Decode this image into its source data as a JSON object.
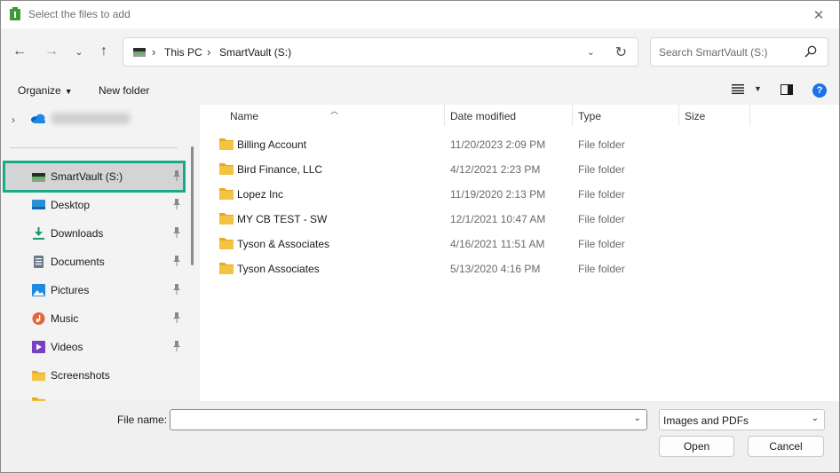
{
  "window": {
    "title": "Select the files to add"
  },
  "nav": {
    "address": {
      "segments": [
        "This PC",
        "SmartVault (S:)"
      ]
    },
    "search_placeholder": "Search SmartVault (S:)"
  },
  "commandbar": {
    "organize": "Organize",
    "new_folder": "New folder"
  },
  "sidebar": {
    "items": [
      {
        "label": "SmartVault (S:)",
        "icon": "drive-icon",
        "pinned": true,
        "selected": true
      },
      {
        "label": "Desktop",
        "icon": "desktop-icon",
        "pinned": true
      },
      {
        "label": "Downloads",
        "icon": "download-icon",
        "pinned": true
      },
      {
        "label": "Documents",
        "icon": "documents-icon",
        "pinned": true
      },
      {
        "label": "Pictures",
        "icon": "pictures-icon",
        "pinned": true
      },
      {
        "label": "Music",
        "icon": "music-icon",
        "pinned": true
      },
      {
        "label": "Videos",
        "icon": "videos-icon",
        "pinned": true
      },
      {
        "label": "Screenshots",
        "icon": "folder-icon",
        "pinned": false
      }
    ]
  },
  "filelist": {
    "columns": [
      "Name",
      "Date modified",
      "Type",
      "Size"
    ],
    "rows": [
      {
        "name": "Billing Account",
        "date": "11/20/2023 2:09 PM",
        "type": "File folder"
      },
      {
        "name": "Bird Finance, LLC",
        "date": "4/12/2021 2:23 PM",
        "type": "File folder"
      },
      {
        "name": "Lopez Inc",
        "date": "11/19/2020 2:13 PM",
        "type": "File folder"
      },
      {
        "name": "MY CB TEST - SW",
        "date": "12/1/2021 10:47 AM",
        "type": "File folder"
      },
      {
        "name": "Tyson & Associates",
        "date": "4/16/2021 11:51 AM",
        "type": "File folder"
      },
      {
        "name": "Tyson Associates",
        "date": "5/13/2020 4:16 PM",
        "type": "File folder"
      }
    ]
  },
  "bottom": {
    "file_name_label": "File name:",
    "file_name_value": "",
    "filter": "Images and PDFs",
    "open": "Open",
    "cancel": "Cancel"
  },
  "colors": {
    "selection_outline": "#1aaa8a",
    "folder": "#f5c342",
    "help": "#1a73e8"
  }
}
